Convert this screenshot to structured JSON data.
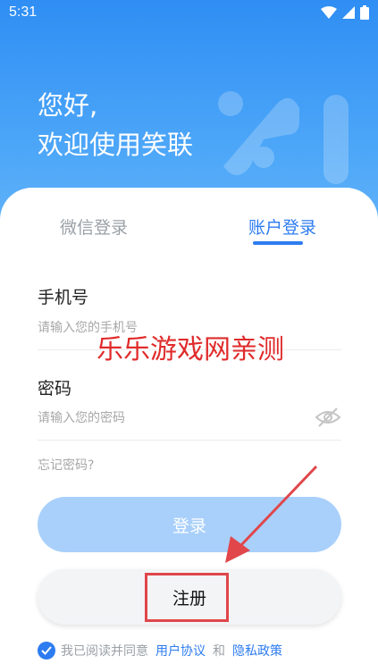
{
  "status": {
    "time": "5:31"
  },
  "greeting": {
    "line1": "您好,",
    "line2": "欢迎使用笑联"
  },
  "tabs": {
    "wechat": "微信登录",
    "account": "账户登录",
    "active": "account"
  },
  "phone": {
    "label": "手机号",
    "placeholder": "请输入您的手机号"
  },
  "password": {
    "label": "密码",
    "placeholder": "请输入您的密码"
  },
  "forgot_password": "忘记密码?",
  "login_button": "登录",
  "register_button": "注册",
  "watermark": "乐乐游戏网亲测",
  "agreement": {
    "prefix": "我已阅读并同意",
    "user_agreement": "用户协议",
    "and": "和",
    "privacy_policy": "隐私政策",
    "checked": true
  },
  "colors": {
    "brand_blue": "#2d7cf0",
    "login_button_disabled": "#a9d0fb",
    "annotation_red": "#e0464a"
  }
}
